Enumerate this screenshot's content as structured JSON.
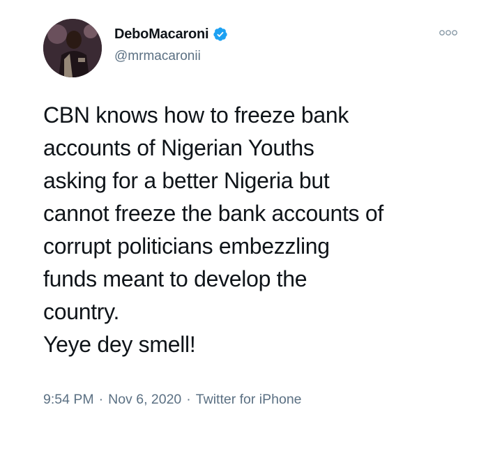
{
  "author": {
    "display_name": "DeboMacaroni",
    "handle": "@mrmacaronii",
    "verified": true
  },
  "tweet": {
    "text": "CBN knows how to freeze bank\naccounts of Nigerian Youths\nasking for a better Nigeria but\ncannot freeze the bank accounts of\ncorrupt politicians embezzling\nfunds meant to develop the\ncountry.\nYeye dey smell!"
  },
  "meta": {
    "time": "9:54 PM",
    "date": "Nov 6, 2020",
    "source": "Twitter for iPhone",
    "separator": "·"
  },
  "icons": {
    "verified": "verified-badge-icon",
    "more": "more-options-icon"
  },
  "colors": {
    "verified_blue": "#1da1f2",
    "secondary_text": "#5b7083",
    "primary_text": "#0f1419"
  }
}
